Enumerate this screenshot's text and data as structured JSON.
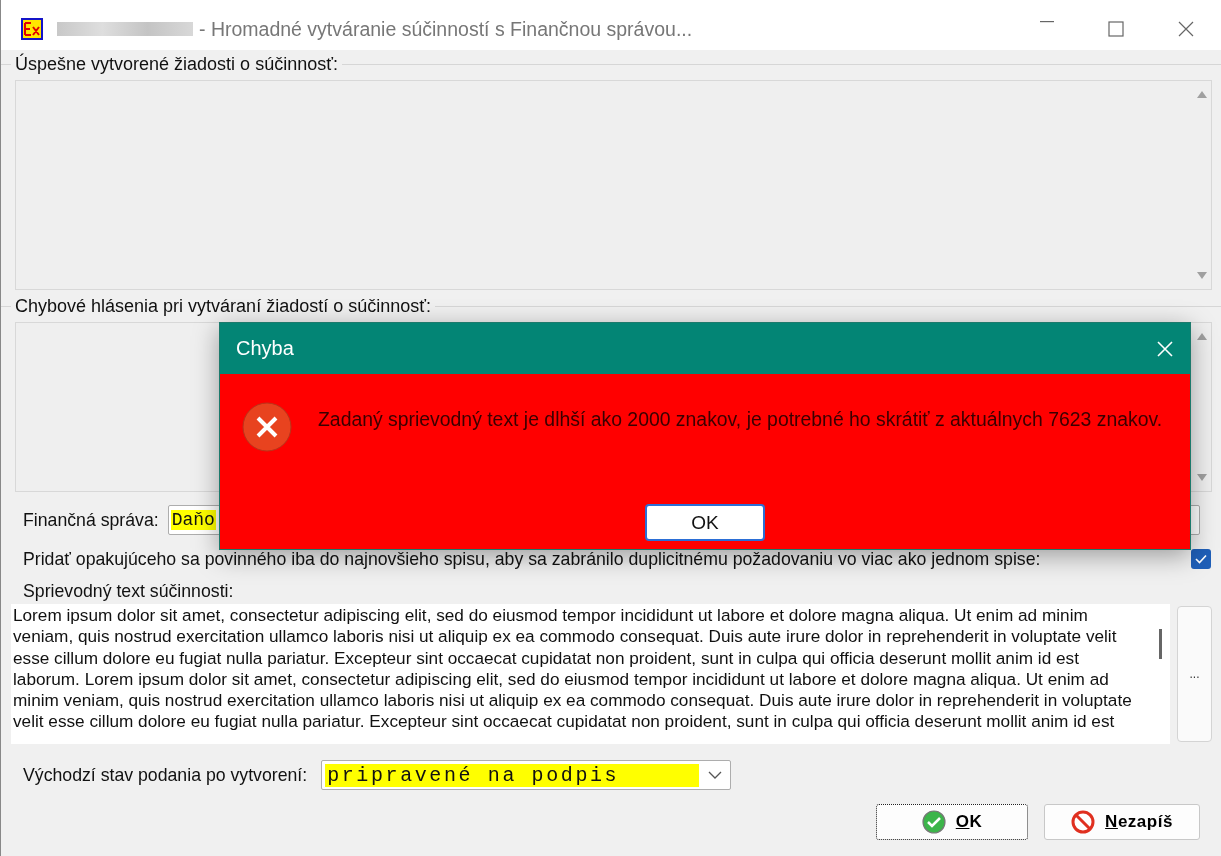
{
  "window": {
    "title": "- Hromadné vytváranie súčinností s Finančnou správou..."
  },
  "success_group": {
    "label": "Úspešne vytvorené žiadosti o súčinnosť:"
  },
  "errors_group": {
    "label": "Chybové hlásenia pri vytváraní žiadostí o súčinnosť:"
  },
  "tax_office": {
    "label": "Finančná správa:",
    "value": "Daňo"
  },
  "dedupe": {
    "label": "Pridať opakujúceho sa povinného iba do najnovšieho spisu, aby sa zabránilo duplicitnému požadovaniu vo viac ako jednom spise:",
    "checked": true
  },
  "cover_text": {
    "label": "Sprievodný text súčinnosti:",
    "value": "Lorem ipsum dolor sit amet, consectetur adipiscing elit, sed do eiusmod tempor incididunt ut labore et dolore magna aliqua. Ut enim ad minim\nveniam, quis nostrud exercitation ullamco laboris nisi ut aliquip ex ea commodo consequat. Duis aute irure dolor in reprehenderit in voluptate velit\nesse cillum dolore eu fugiat nulla pariatur. Excepteur sint occaecat cupidatat non proident, sunt in culpa qui officia deserunt mollit anim id est\nlaborum. Lorem ipsum dolor sit amet, consectetur adipiscing elit, sed do eiusmod tempor incididunt ut labore et dolore magna aliqua. Ut enim ad\nminim veniam, quis nostrud exercitation ullamco laboris nisi ut aliquip ex ea commodo consequat. Duis aute irure dolor in reprehenderit in voluptate\nvelit esse cillum dolore eu fugiat nulla pariatur. Excepteur sint occaecat cupidatat non proident, sunt in culpa qui officia deserunt mollit anim id est",
    "more_button": "..."
  },
  "initial_state": {
    "label": "Východzí stav podania po vytvorení:",
    "value": "pripravené na podpis"
  },
  "buttons": [
    {
      "kind": "ok",
      "label": "OK"
    },
    {
      "kind": "cancel",
      "label": "Nezapíš"
    }
  ],
  "dialog": {
    "title": "Chyba",
    "message": "Zadaný sprievodný text je dlhší ako 2000 znakov, je potrebné ho skrátiť z aktuálnych 7623 znakov.",
    "button": "OK"
  }
}
